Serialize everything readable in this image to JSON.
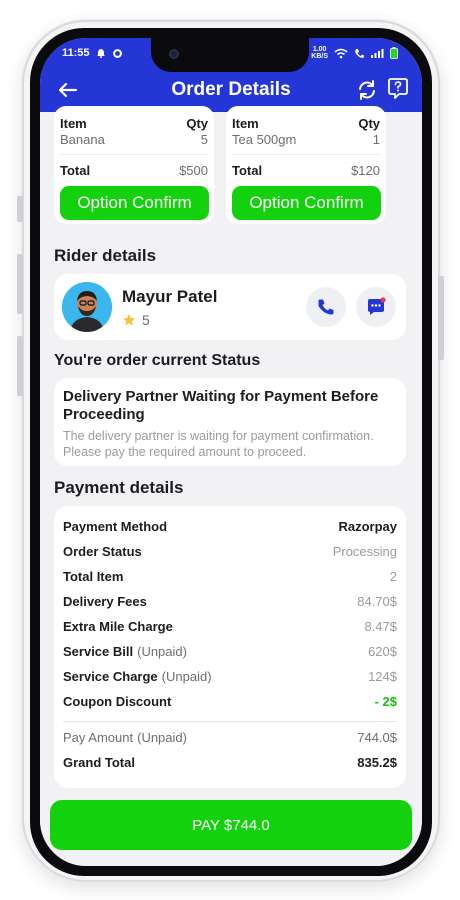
{
  "status_bar": {
    "time": "11:55",
    "speed_value": "1.00",
    "speed_unit": "KB/S"
  },
  "app_bar": {
    "title": "Order Details"
  },
  "item_cards": [
    {
      "item_header": "Item",
      "qty_header": "Qty",
      "item_name": "Banana",
      "item_qty": "5",
      "total_label": "Total",
      "total_value": "$500",
      "button_label": "Option Confirm"
    },
    {
      "item_header": "Item",
      "qty_header": "Qty",
      "item_name": "Tea 500gm",
      "item_qty": "1",
      "total_label": "Total",
      "total_value": "$120",
      "button_label": "Option Confirm"
    }
  ],
  "rider": {
    "section_title": "Rider details",
    "name": "Mayur Patel",
    "rating": "5"
  },
  "order_status": {
    "section_title": "You're order current Status",
    "title": "Delivery Partner Waiting for Payment Before Proceeding",
    "description": "The delivery partner is waiting for payment confirmation. Please pay the required amount to proceed."
  },
  "payment": {
    "section_title": "Payment details",
    "rows": [
      {
        "label": "Payment Method",
        "note": "",
        "value": "Razorpay"
      },
      {
        "label": "Order Status",
        "note": "",
        "value": "Processing"
      },
      {
        "label": "Total Item",
        "note": "",
        "value": "2"
      },
      {
        "label": "Delivery Fees",
        "note": "",
        "value": "84.70$"
      },
      {
        "label": "Extra Mile Charge",
        "note": "",
        "value": "8.47$"
      },
      {
        "label": "Service Bill",
        "note": "(Unpaid)",
        "value": "620$"
      },
      {
        "label": "Service Charge",
        "note": "(Unpaid)",
        "value": "124$"
      },
      {
        "label": "Coupon Discount",
        "note": "",
        "value": "- 2$"
      }
    ],
    "pay_amount_label": "Pay Amount",
    "pay_amount_note": "(Unpaid)",
    "pay_amount_value": "744.0$",
    "grand_total_label": "Grand Total",
    "grand_total_value": "835.2$"
  },
  "pay_button": {
    "label": "PAY $744.0"
  },
  "colors": {
    "primary": "#2436d6",
    "accent_green": "#14d10d",
    "background": "#f2f2f4"
  }
}
